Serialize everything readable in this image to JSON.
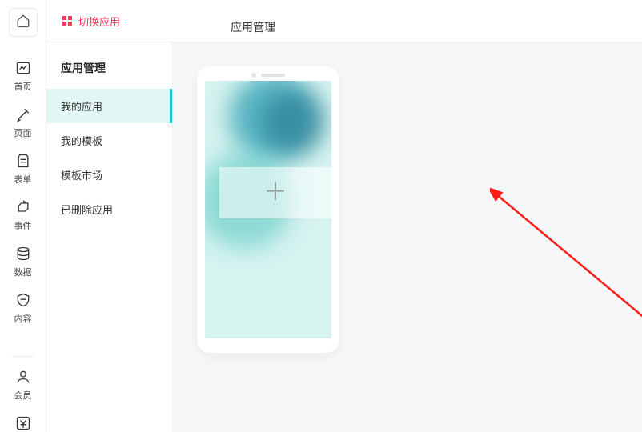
{
  "rail": {
    "items": [
      {
        "label": "首页"
      },
      {
        "label": "页面"
      },
      {
        "label": "表单"
      },
      {
        "label": "事件"
      },
      {
        "label": "数据"
      },
      {
        "label": "内容"
      }
    ],
    "member_label": "会员"
  },
  "top": {
    "switch_app": "切换应用",
    "tabs": [
      {
        "label": "应用管理",
        "active": true
      }
    ]
  },
  "sidebar": {
    "title": "应用管理",
    "items": [
      {
        "label": "我的应用",
        "active": true
      },
      {
        "label": "我的模板"
      },
      {
        "label": "模板市场"
      },
      {
        "label": "已删除应用"
      }
    ]
  }
}
